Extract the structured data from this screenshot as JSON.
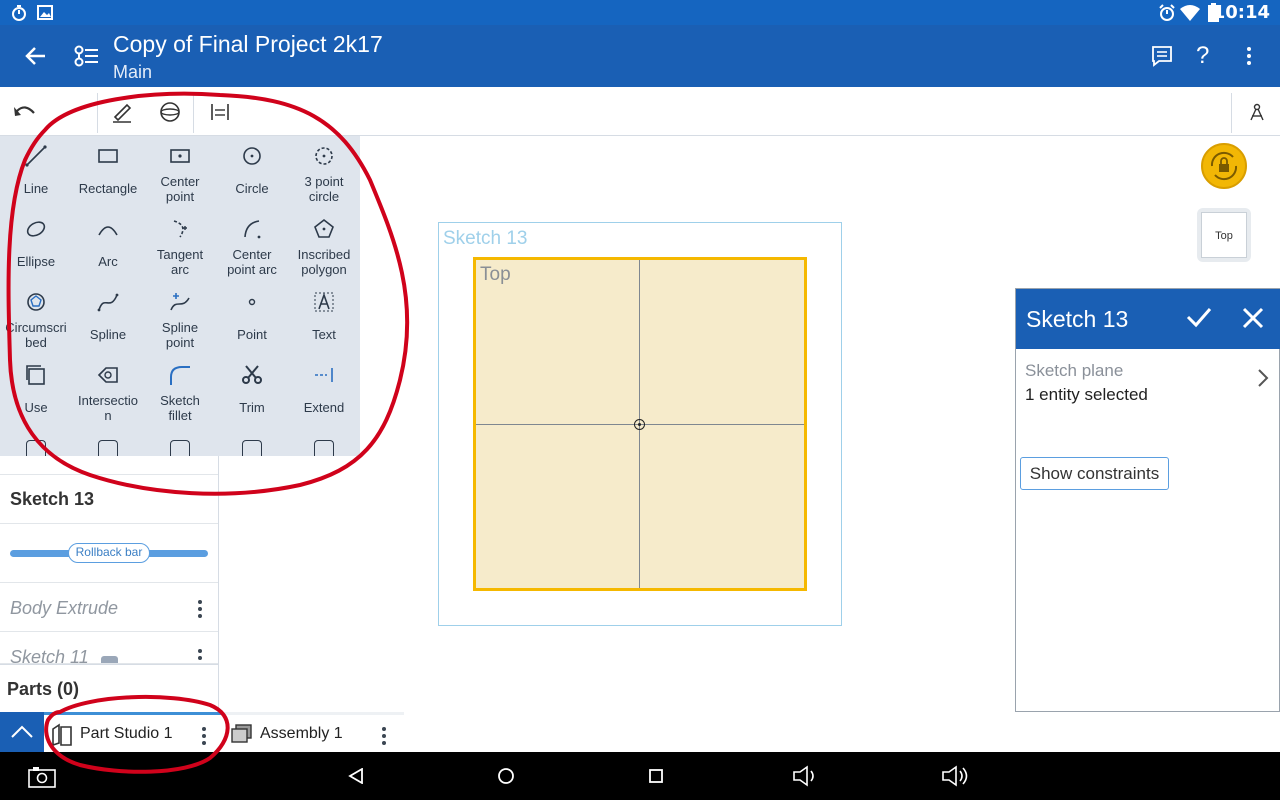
{
  "status_bar": {
    "time": "10:14"
  },
  "app_bar": {
    "title": "Copy of Final Project 2k17",
    "subtitle": "Main",
    "help_label": "?"
  },
  "tools": [
    {
      "label": "Line",
      "icon": "line-icon"
    },
    {
      "label": "Rectangle",
      "icon": "rectangle-icon"
    },
    {
      "label": "Center\npoint",
      "icon": "center-point-rectangle-icon"
    },
    {
      "label": "Circle",
      "icon": "circle-icon"
    },
    {
      "label": "3 point\ncircle",
      "icon": "three-point-circle-icon"
    },
    {
      "label": "Ellipse",
      "icon": "ellipse-icon"
    },
    {
      "label": "Arc",
      "icon": "arc-icon"
    },
    {
      "label": "Tangent\narc",
      "icon": "tangent-arc-icon"
    },
    {
      "label": "Center\npoint arc",
      "icon": "center-point-arc-icon"
    },
    {
      "label": "Inscribed\npolygon",
      "icon": "inscribed-polygon-icon"
    },
    {
      "label": "Circumscri\nbed",
      "icon": "circumscribed-polygon-icon"
    },
    {
      "label": "Spline",
      "icon": "spline-icon"
    },
    {
      "label": "Spline\npoint",
      "icon": "spline-point-icon"
    },
    {
      "label": "Point",
      "icon": "point-icon"
    },
    {
      "label": "Text",
      "icon": "text-icon"
    },
    {
      "label": "Use",
      "icon": "use-icon"
    },
    {
      "label": "Intersectio\nn",
      "icon": "intersection-icon"
    },
    {
      "label": "Sketch\nfillet",
      "icon": "sketch-fillet-icon"
    },
    {
      "label": "Trim",
      "icon": "trim-icon"
    },
    {
      "label": "Extend",
      "icon": "extend-icon"
    }
  ],
  "feature_list": {
    "active_sketch": "Sketch 13",
    "rollback_label": "Rollback bar",
    "items": [
      "Body Extrude",
      "Sketch 11"
    ],
    "parts_label": "Parts (0)"
  },
  "canvas": {
    "sketch_label": "Sketch 13",
    "plane_label": "Top",
    "view_cube_label": "Top"
  },
  "sketch_dialog": {
    "title": "Sketch 13",
    "plane_label": "Sketch plane",
    "plane_value": "1 entity selected",
    "constraints_button": "Show constraints"
  },
  "tabs": [
    {
      "label": "Part Studio 1",
      "active": true
    },
    {
      "label": "Assembly 1",
      "active": false
    }
  ],
  "colors": {
    "app_bar": "#1a5fb4",
    "status_bar": "#1565c0",
    "sketch_plane": "#f6ebcb",
    "sketch_border": "#f5b800",
    "annotation": "#d0021b",
    "view_lock": "#f2b705"
  }
}
